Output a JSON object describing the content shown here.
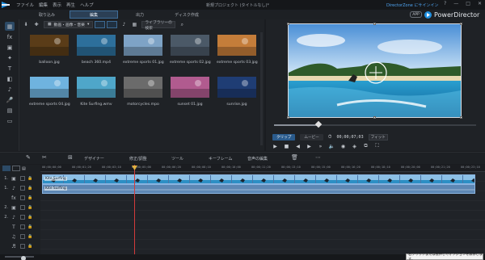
{
  "menu": [
    "ファイル",
    "編集",
    "表示",
    "再生",
    "ヘルプ"
  ],
  "title": "新規プロジェクト (タイトルなし)*",
  "directorzone_link": "DirectorZone にサインイン",
  "window_controls": [
    "?",
    "—",
    "□",
    "✕"
  ],
  "mode_tabs": [
    "取り込み",
    "編集",
    "出力",
    "ディスク作成"
  ],
  "app_badge": "APP",
  "brand": "PowerDirector",
  "library": {
    "filter_label": "動画・画像・音楽",
    "search_placeholder": "ライブラリーの検索",
    "items": [
      {
        "label": "balloon.jpg",
        "color": "#5a3c18"
      },
      {
        "label": "beach 360.mp4",
        "color": "#2d6f9b"
      },
      {
        "label": "extreme sports 01.jpg",
        "color": "#7ea3c6"
      },
      {
        "label": "extreme sports 02.jpg",
        "color": "#4b5967"
      },
      {
        "label": "extreme sports 03.jpg",
        "color": "#c47d3a"
      },
      {
        "label": "extreme sports 04.jpg",
        "color": "#6fb3df"
      },
      {
        "label": "Kite Surfing.wmv",
        "color": "#4fa6c9"
      },
      {
        "label": "motorcycles.mpo",
        "color": "#6b6b6b"
      },
      {
        "label": "sunset 01.jpg",
        "color": "#b15b8f"
      },
      {
        "label": "sunrise.jpg",
        "color": "#1f3d74"
      }
    ]
  },
  "preview": {
    "clip_tab": "クリップ",
    "movie_tab": "ムービー",
    "timecode": "00;00;07;03",
    "fit": "フィット",
    "seek_progress": 0.22
  },
  "editbar": {
    "designer": "デザイナー",
    "fix_enhance": "修正/調整",
    "tools": "ツール",
    "keyframe": "キーフレーム",
    "audio_mixing": "音声の編集"
  },
  "timeline": {
    "ticks": [
      "00;00;00;00",
      "00;00;01;20",
      "00;00;03;10",
      "00;00;05;00",
      "00;00;06;20",
      "00;00;08;10",
      "00;00;10;00",
      "00;00;11;20",
      "00;00;13;10",
      "00;00;15;00",
      "00;00;16;20",
      "00;00;18;10",
      "00;00;20;00",
      "00;00;21;20",
      "00;00;23;10"
    ],
    "tracks": [
      {
        "num": "1.",
        "icon": "▣"
      },
      {
        "num": "1.",
        "icon": "♪"
      },
      {
        "num": "",
        "icon": "fx"
      },
      {
        "num": "2.",
        "icon": "▣"
      },
      {
        "num": "2.",
        "icon": "♪"
      },
      {
        "num": "",
        "icon": "T"
      },
      {
        "num": "",
        "icon": "♫"
      },
      {
        "num": "",
        "icon": "♬"
      }
    ],
    "clip_label": "Kite Surfing",
    "audio_label": "Kite Surfing"
  },
  "tooltip": "右クリックまたは長押しでオプションを表示します。"
}
